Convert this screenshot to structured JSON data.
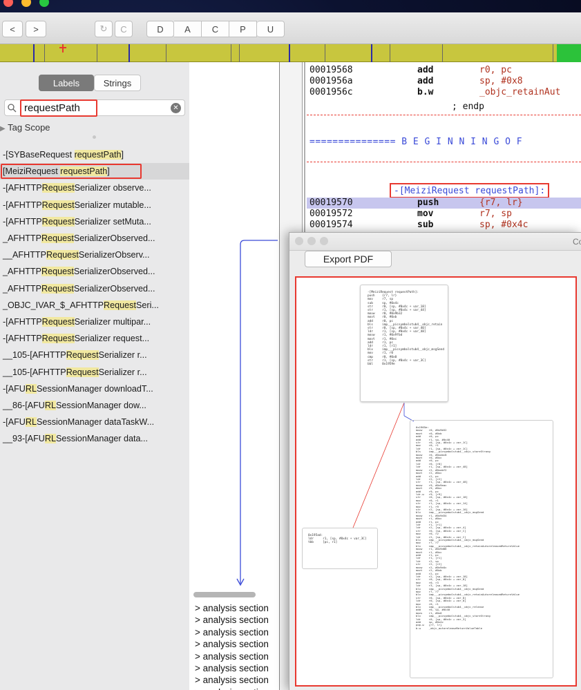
{
  "toolbar": {
    "nav_back": "<",
    "nav_forward": ">",
    "refresh_a": "↻",
    "refresh_b": "C",
    "modes": [
      "D",
      "A",
      "C",
      "P",
      "U"
    ]
  },
  "sidebar": {
    "tabs": [
      "Labels",
      "Strings"
    ],
    "search_value": "requestPath",
    "tag_scope": "Tag Scope",
    "labels": [
      {
        "pre": "-[SYBaseRequest ",
        "hl": "requestPath",
        "post": "]"
      },
      {
        "pre": "[MeiziRequest ",
        "hl": "requestPath",
        "post": "]"
      },
      {
        "pre": "-[AFHTTP",
        "hl": "Request",
        "post": "Serializer observe..."
      },
      {
        "pre": "-[AFHTTP",
        "hl": "Request",
        "post": "Serializer mutable..."
      },
      {
        "pre": "-[AFHTTP",
        "hl": "Request",
        "post": "Serializer setMuta..."
      },
      {
        "pre": "_AFHTTP",
        "hl": "Request",
        "post": "SerializerObserved..."
      },
      {
        "pre": "__AFHTTP",
        "hl": "Request",
        "post": "SerializerObserv..."
      },
      {
        "pre": "_AFHTTP",
        "hl": "Request",
        "post": "SerializerObserved..."
      },
      {
        "pre": "_AFHTTP",
        "hl": "Request",
        "post": "SerializerObserved..."
      },
      {
        "pre": "_OBJC_IVAR_$_AFHTTP",
        "hl": "Request",
        "post": "Seri..."
      },
      {
        "pre": "-[AFHTTP",
        "hl": "Request",
        "post": "Serializer multipar..."
      },
      {
        "pre": "-[AFHTTP",
        "hl": "Request",
        "post": "Serializer request..."
      },
      {
        "pre": "__105-[AFHTTP",
        "hl": "Request",
        "post": "Serializer r..."
      },
      {
        "pre": "__105-[AFHTTP",
        "hl": "Request",
        "post": "Serializer r..."
      },
      {
        "pre": "-[AFU",
        "hl": "RL",
        "post": "SessionManager downloadT..."
      },
      {
        "pre": "__86-[AFU",
        "hl": "RL",
        "post": "SessionManager dow..."
      },
      {
        "pre": "-[AFU",
        "hl": "RL",
        "post": "SessionManager dataTaskW..."
      },
      {
        "pre": "__93-[AFU",
        "hl": "RL",
        "post": "SessionManager data..."
      }
    ]
  },
  "asm": {
    "rows": [
      {
        "addr": "00019568",
        "op": "add",
        "arg": "r0, pc"
      },
      {
        "addr": "0001956a",
        "op": "add",
        "arg": "sp, #0x8"
      },
      {
        "addr": "0001956c",
        "op": "b.w",
        "arg": "_objc_retainAut"
      }
    ],
    "endp": "; endp",
    "banner": "=============== B E G I N N I N G   O F",
    "proc_label": "-[MeiziRequest requestPath]:",
    "rows2": [
      {
        "addr": "00019570",
        "op": "push",
        "arg": "{r7, lr}"
      },
      {
        "addr": "00019572",
        "op": "mov",
        "arg": "r7, sp"
      },
      {
        "addr": "00019574",
        "op": "sub",
        "arg": "sp, #0x4c"
      }
    ]
  },
  "pdf_window": {
    "export_label": "Export PDF",
    "title_partial": "Co"
  },
  "analysis": {
    "lines": [
      "> analysis section",
      "> analysis section",
      "> analysis section",
      "> analysis section",
      "> analysis section",
      "> analysis section",
      "> analysis section",
      "> analysis section"
    ]
  },
  "colors": {
    "accent_red": "#e8382f",
    "selection": "#c7c6ee",
    "navbar": "#c8c63e",
    "highlight": "#f1e8a0"
  }
}
